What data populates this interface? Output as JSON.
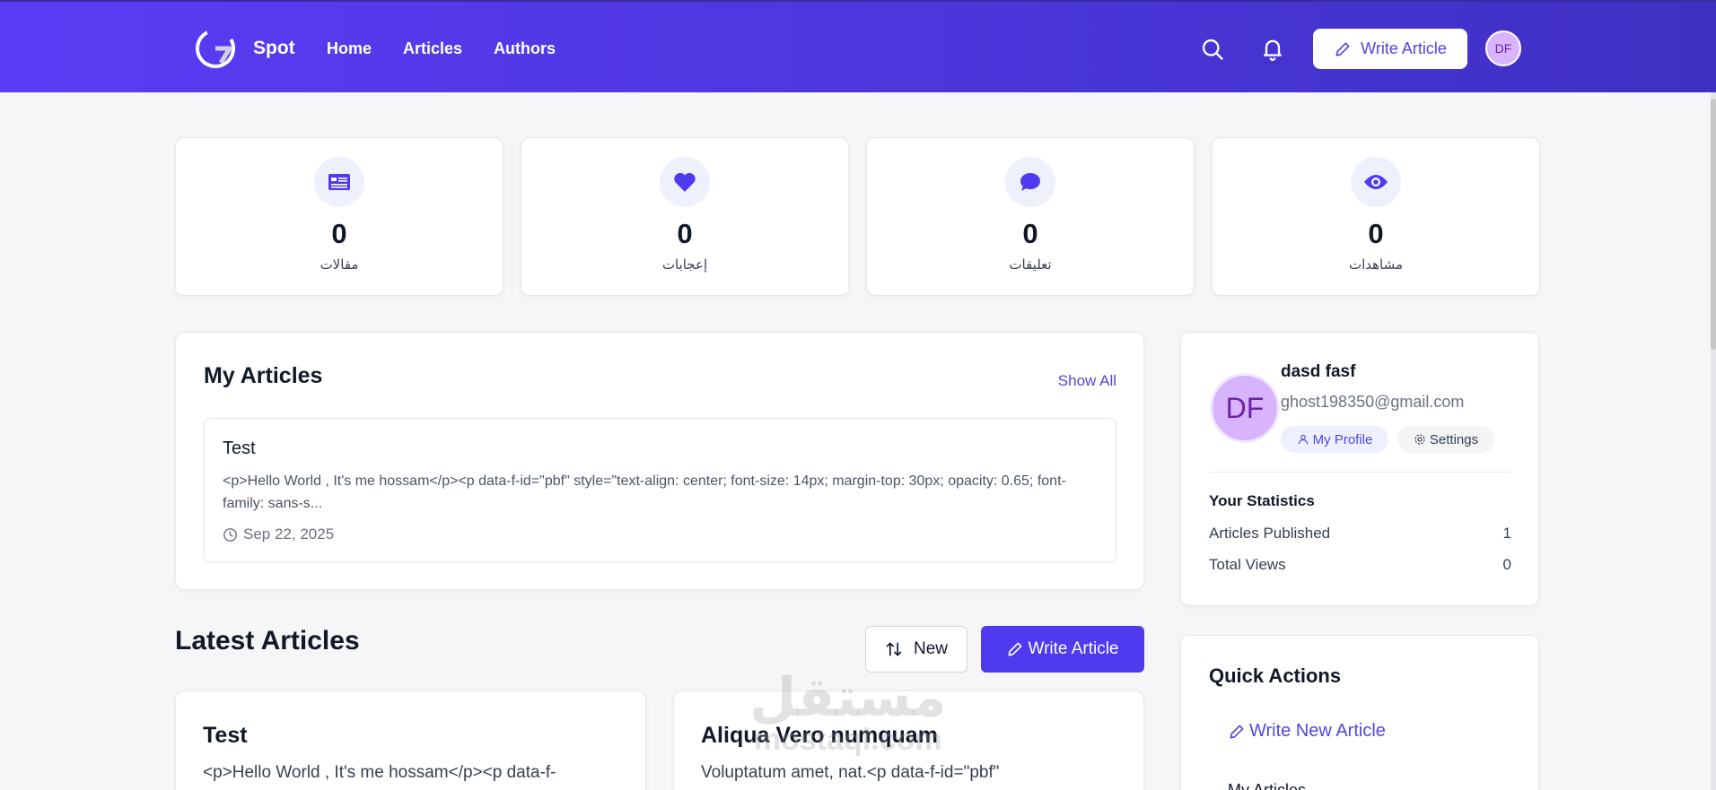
{
  "header": {
    "brand": "Spot",
    "nav": [
      "Home",
      "Articles",
      "Authors"
    ],
    "write_label": "Write Article",
    "avatar_initials": "DF"
  },
  "stats": [
    {
      "icon": "newspaper-icon",
      "value": "0",
      "label": "مقالات"
    },
    {
      "icon": "heart-icon",
      "value": "0",
      "label": "إعجابات"
    },
    {
      "icon": "comment-icon",
      "value": "0",
      "label": "تعليقات"
    },
    {
      "icon": "eye-icon",
      "value": "0",
      "label": "مشاهدات"
    }
  ],
  "my_articles": {
    "title": "My Articles",
    "show_all": "Show All",
    "items": [
      {
        "title": "Test",
        "excerpt": "<p>Hello World , It's me hossam</p><p data-f-id=\"pbf\" style=\"text-align: center; font-size: 14px; margin-top: 30px; opacity: 0.65; font-family: sans-s...",
        "date": "Sep 22, 2025"
      }
    ]
  },
  "latest": {
    "title": "Latest Articles",
    "sort_label": "New",
    "write_label": "Write Article",
    "items": [
      {
        "title": "Test",
        "excerpt": "<p>Hello World , It's me hossam</p><p data-f-"
      },
      {
        "title": "Aliqua Vero numquam",
        "excerpt": "Voluptatum amet, nat.<p data-f-id=\"pbf\""
      }
    ]
  },
  "profile": {
    "initials": "DF",
    "name": "dasd fasf",
    "email": "ghost198350@gmail.com",
    "my_profile": "My Profile",
    "settings": "Settings",
    "stats_title": "Your Statistics",
    "rows": [
      {
        "label": "Articles Published",
        "value": "1"
      },
      {
        "label": "Total Views",
        "value": "0"
      }
    ]
  },
  "quick_actions": {
    "title": "Quick Actions",
    "write_new": "Write New Article",
    "my_articles": "My Articles"
  },
  "watermark": {
    "line1": "مستقل",
    "line2": "mostaql.com"
  },
  "colors": {
    "primary": "#4f46e5",
    "header_start": "#5b3cf5",
    "header_end": "#3f2fc2",
    "avatar": "#d8b4fe"
  }
}
